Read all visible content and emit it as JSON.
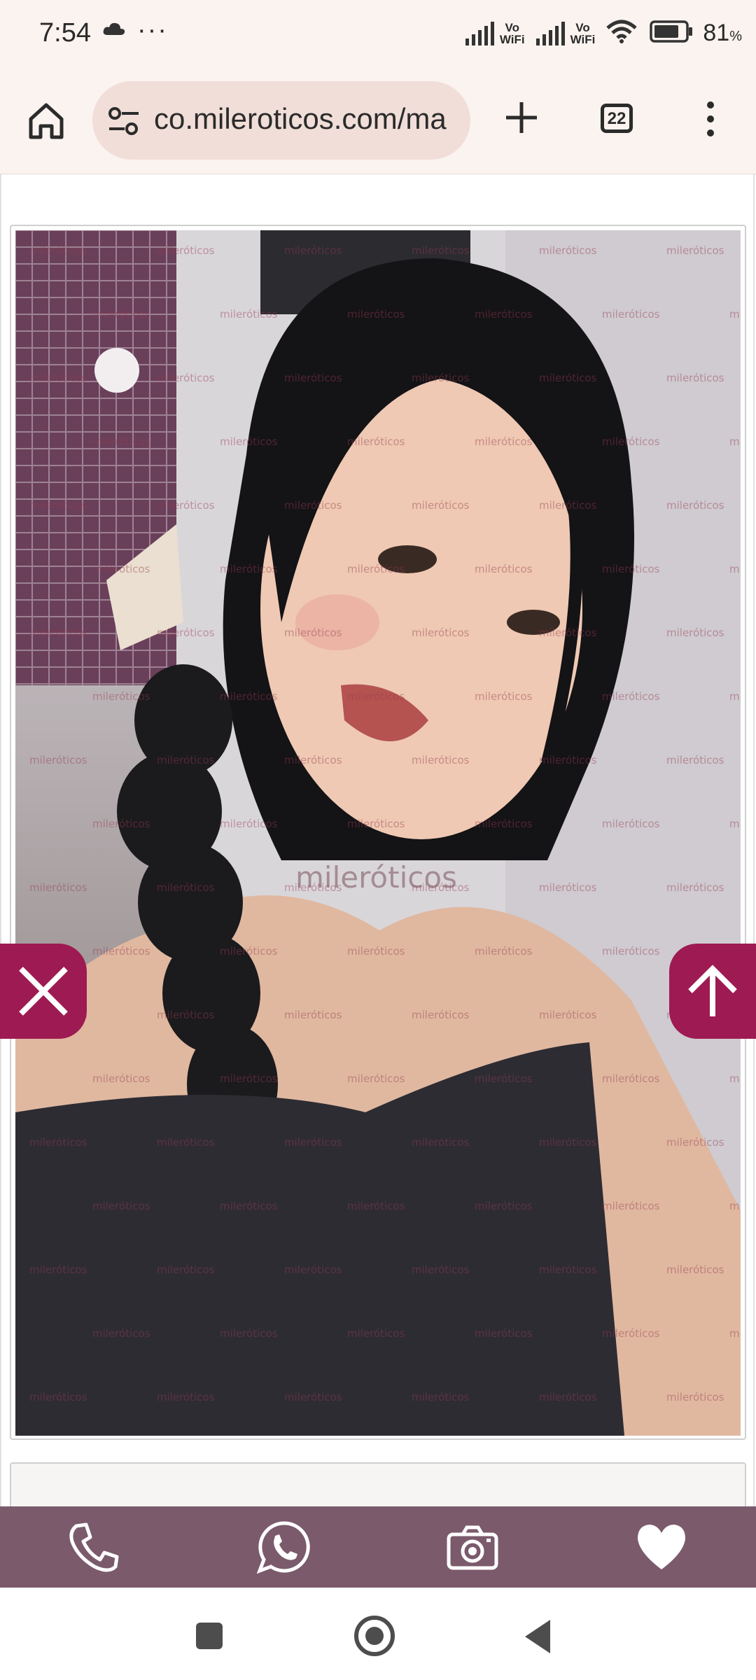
{
  "status_bar": {
    "time": "7:54",
    "overflow": "···",
    "signal_1_label_top": "Vo",
    "signal_1_label_bottom": "WiFi",
    "signal_2_label_top": "Vo",
    "signal_2_label_bottom": "WiFi",
    "battery_number": "81",
    "battery_unit": "%",
    "battery_level": 0.81,
    "icons": [
      "cloud-icon",
      "signal-icon",
      "wifi-icon",
      "battery-icon"
    ]
  },
  "browser": {
    "url": "co.mileroticos.com/ma",
    "tab_count": "22",
    "icons": [
      "home-icon",
      "site-settings-icon",
      "new-tab-icon",
      "tabs-icon",
      "menu-icon"
    ]
  },
  "photo": {
    "watermark_text": "mileróticos",
    "big_watermark_text": "mileróticos"
  },
  "floating": {
    "close_icon": "close-icon",
    "up_icon": "arrow-up-icon",
    "accent_color": "#9e1a52"
  },
  "action_bar": {
    "color": "#7b5a6c",
    "icons": [
      "phone-icon",
      "whatsapp-icon",
      "camera-icon",
      "heart-icon"
    ]
  },
  "nav_bar": {
    "icons": [
      "recents-icon",
      "home-icon",
      "back-icon"
    ]
  }
}
